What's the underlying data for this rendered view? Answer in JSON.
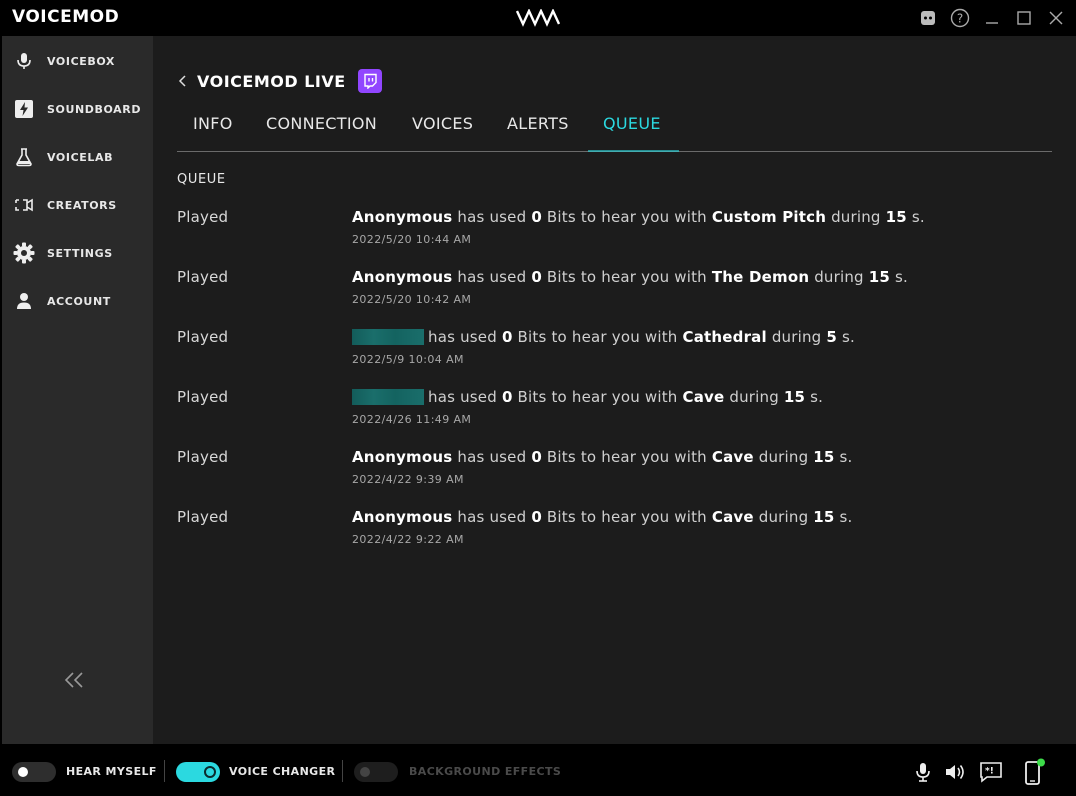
{
  "app": {
    "title": "VOICEMOD",
    "window_controls": [
      "discord-icon",
      "help-icon",
      "minimize-icon",
      "maximize-icon",
      "close-icon"
    ]
  },
  "sidebar": {
    "items": [
      {
        "label": "VOICEBOX",
        "icon": "microphone-icon"
      },
      {
        "label": "SOUNDBOARD",
        "icon": "lightning-icon"
      },
      {
        "label": "VOICELAB",
        "icon": "flask-icon"
      },
      {
        "label": "CREATORS",
        "icon": "video-icon"
      },
      {
        "label": "SETTINGS",
        "icon": "gear-icon"
      },
      {
        "label": "ACCOUNT",
        "icon": "user-icon"
      }
    ],
    "collapse_icon": "double-chevron-left-icon"
  },
  "header": {
    "title": "VOICEMOD LIVE",
    "platform_icon": "twitch-icon",
    "platform_color": "#9146ff"
  },
  "tabs": [
    {
      "label": "INFO",
      "active": false
    },
    {
      "label": "CONNECTION",
      "active": false
    },
    {
      "label": "VOICES",
      "active": false
    },
    {
      "label": "ALERTS",
      "active": false
    },
    {
      "label": "QUEUE",
      "active": true
    }
  ],
  "accent_color": "#2bd9e0",
  "queue": {
    "title": "QUEUE",
    "phrase_used": "has used",
    "phrase_bits": "Bits to hear you with",
    "phrase_during": "during",
    "phrase_unit": "s.",
    "entries": [
      {
        "status": "Played",
        "user": "Anonymous",
        "bits": "0",
        "voice": "Custom Pitch",
        "duration": "15",
        "time": "2022/5/20 10:44 AM"
      },
      {
        "status": "Played",
        "user": "Anonymous",
        "bits": "0",
        "voice": "The Demon",
        "duration": "15",
        "time": "2022/5/20 10:42 AM"
      },
      {
        "status": "Played",
        "user": "",
        "bits": "0",
        "voice": "Cathedral",
        "duration": "5",
        "time": "2022/5/9 10:04 AM"
      },
      {
        "status": "Played",
        "user": "",
        "bits": "0",
        "voice": "Cave",
        "duration": "15",
        "time": "2022/4/26 11:49 AM"
      },
      {
        "status": "Played",
        "user": "Anonymous",
        "bits": "0",
        "voice": "Cave",
        "duration": "15",
        "time": "2022/4/22 9:39 AM"
      },
      {
        "status": "Played",
        "user": "Anonymous",
        "bits": "0",
        "voice": "Cave",
        "duration": "15",
        "time": "2022/4/22 9:22 AM"
      }
    ]
  },
  "bottombar": {
    "hear_myself": {
      "label": "HEAR MYSELF",
      "on": false
    },
    "voice_changer": {
      "label": "VOICE CHANGER",
      "on": true
    },
    "background_effects": {
      "label": "BACKGROUND EFFECTS",
      "on": false,
      "disabled": true
    },
    "right_icons": [
      "microphone-icon",
      "speaker-icon",
      "chat-command-icon",
      "mobile-icon"
    ],
    "status_dot_color": "#3ddc4a"
  }
}
